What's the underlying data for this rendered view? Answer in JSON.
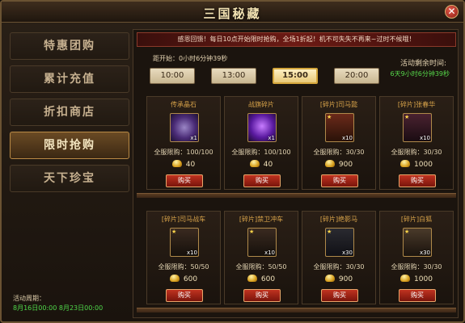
{
  "window": {
    "title": "三国秘藏",
    "close_label": "✕"
  },
  "menu": [
    {
      "label": "特惠团购",
      "active": false
    },
    {
      "label": "累计充值",
      "active": false
    },
    {
      "label": "折扣商店",
      "active": false
    },
    {
      "label": "限时抢购",
      "active": true
    },
    {
      "label": "天下珍宝",
      "active": false
    }
  ],
  "event_period": {
    "label": "活动周期：",
    "value": "8月16日00:00  8月23日00:00"
  },
  "banner": "感恩回馈！每日10点开始限时抢购，全场1折起！机不可失失不再来~过时不候哦！",
  "countdown": "距开始：0小时6分钟39秒",
  "remaining": {
    "label": "活动剩余时间:",
    "value": "6天9小时6分钟39秒"
  },
  "tabs": [
    {
      "label": "10:00",
      "active": false
    },
    {
      "label": "13:00",
      "active": false
    },
    {
      "label": "15:00",
      "active": true
    },
    {
      "label": "20:00",
      "active": false
    }
  ],
  "items": [
    {
      "name": "传承晶石",
      "qty": "x1",
      "limit": "全服限购：100/100",
      "price": "40",
      "buy": "购买",
      "icon": "stone-icon"
    },
    {
      "name": "战旗碎片",
      "qty": "x1",
      "limit": "全服限购：100/100",
      "price": "40",
      "buy": "购买",
      "icon": "crystal-icon"
    },
    {
      "name": "[碎片]司马懿",
      "qty": "x10",
      "limit": "全服限购：30/30",
      "price": "900",
      "buy": "购买",
      "icon": "general-portrait-icon"
    },
    {
      "name": "[碎片]张春华",
      "qty": "x10",
      "limit": "全服限购：30/30",
      "price": "1000",
      "buy": "购买",
      "icon": "lady-portrait-icon"
    },
    {
      "name": "[碎片]司马战车",
      "qty": "x10",
      "limit": "全服限购：50/50",
      "price": "600",
      "buy": "购买",
      "icon": "chariot-icon"
    },
    {
      "name": "[碎片]禁卫冲车",
      "qty": "x10",
      "limit": "全服限购：50/50",
      "price": "600",
      "buy": "购买",
      "icon": "chariot-icon"
    },
    {
      "name": "[碎片]绝影马",
      "qty": "x30",
      "limit": "全服限购：30/30",
      "price": "900",
      "buy": "购买",
      "icon": "horse-icon"
    },
    {
      "name": "[碎片]白狐",
      "qty": "x30",
      "limit": "全服限购：30/30",
      "price": "1000",
      "buy": "购买",
      "icon": "fox-icon"
    }
  ],
  "colors": {
    "accent_green": "#56d84a",
    "button_red": "#c0321f",
    "item_name": "#d8a34a"
  }
}
